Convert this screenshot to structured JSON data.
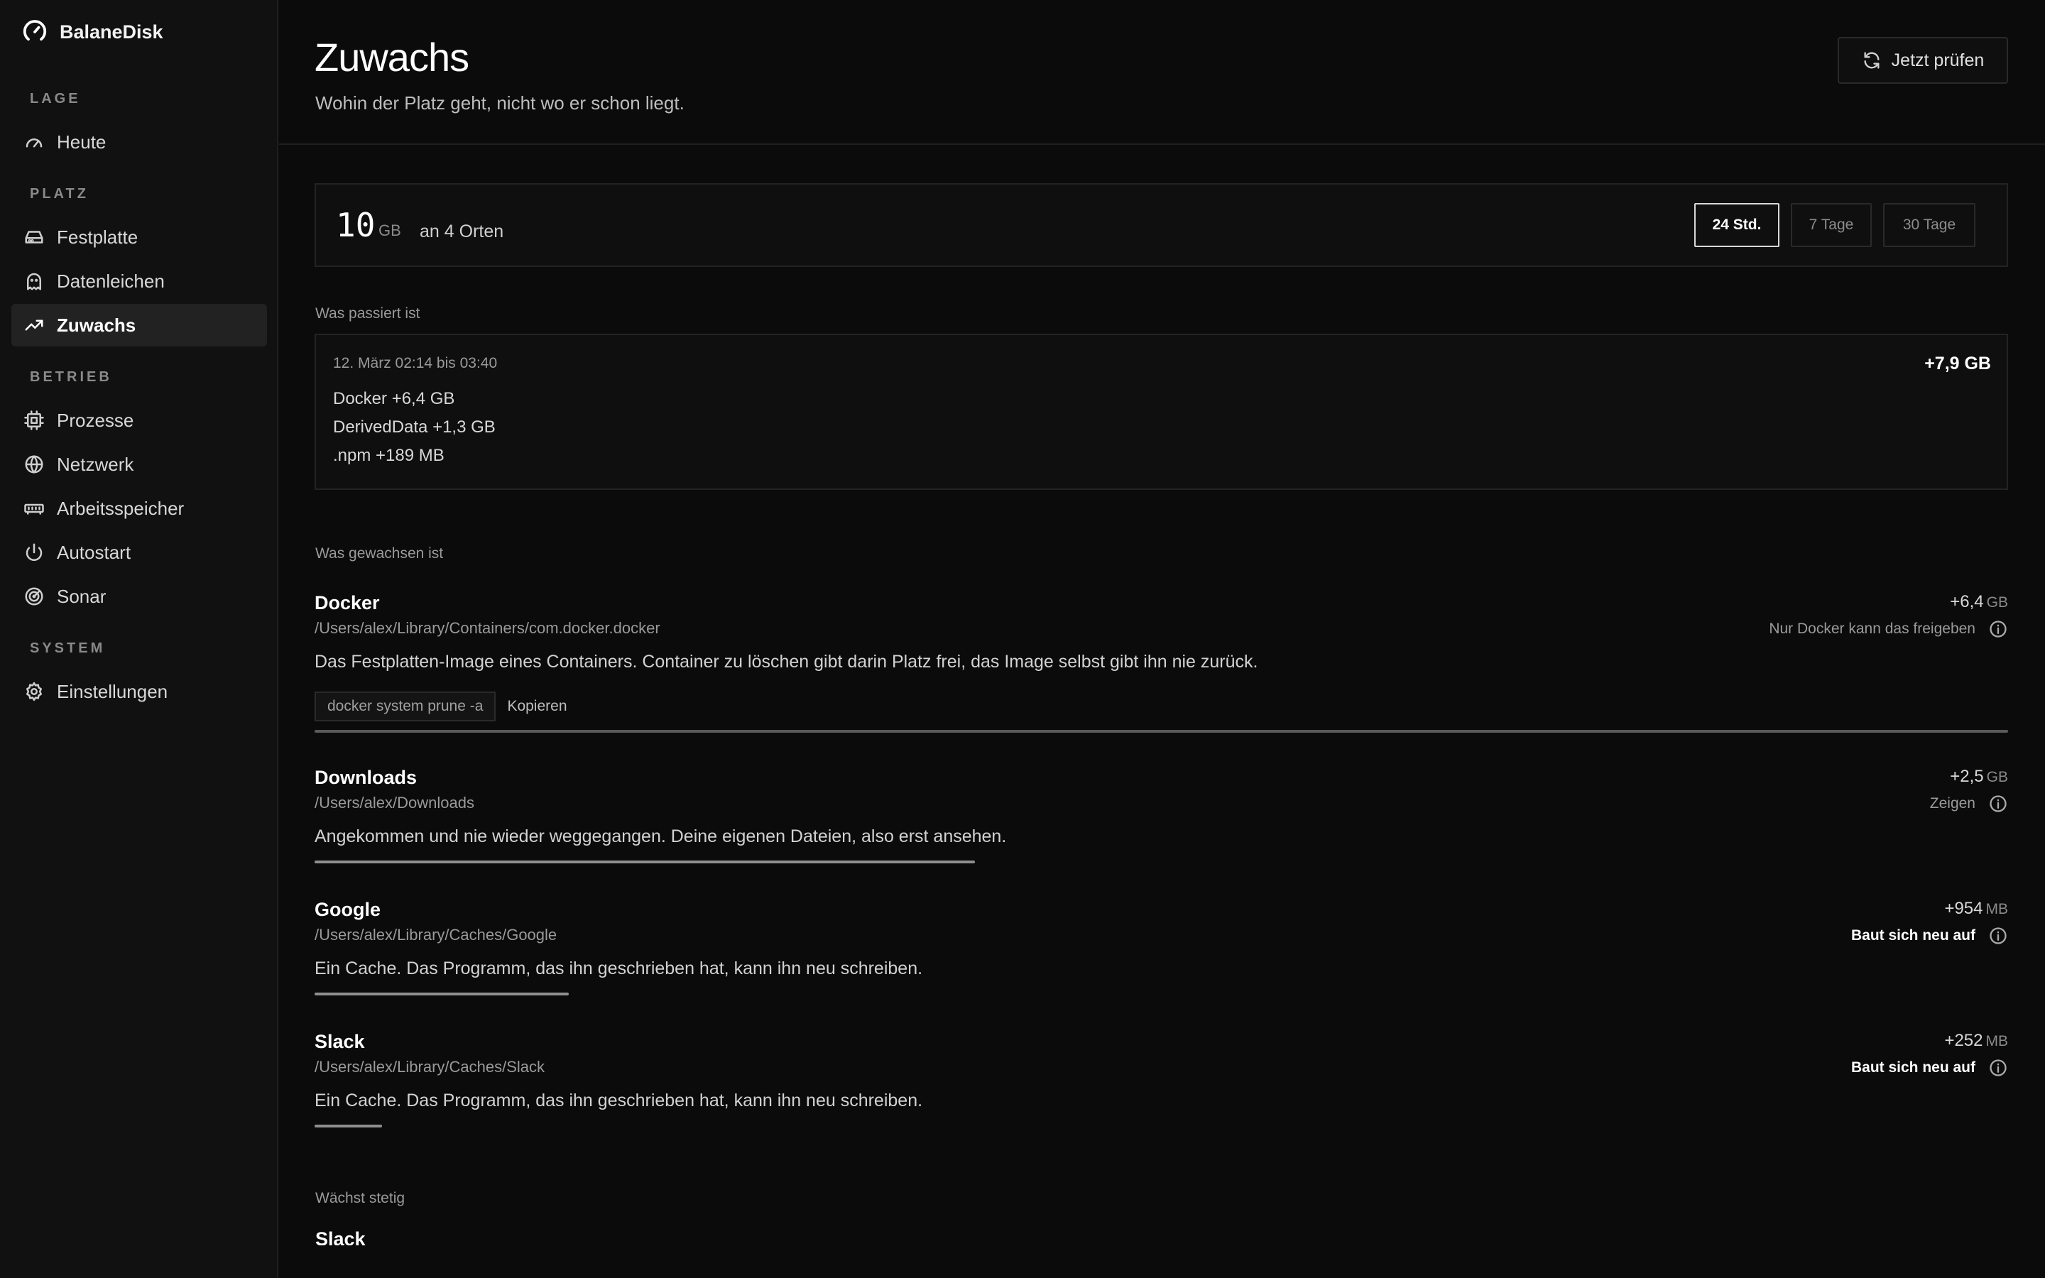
{
  "app": {
    "name": "BalaneDisk"
  },
  "sidebar": {
    "sections": [
      {
        "title": "LAGE",
        "items": [
          {
            "label": "Heute",
            "icon": "gauge-icon"
          }
        ]
      },
      {
        "title": "PLATZ",
        "items": [
          {
            "label": "Festplatte",
            "icon": "hard-drive-icon"
          },
          {
            "label": "Datenleichen",
            "icon": "ghost-icon"
          },
          {
            "label": "Zuwachs",
            "icon": "trending-up-icon",
            "active": true
          }
        ]
      },
      {
        "title": "BETRIEB",
        "items": [
          {
            "label": "Prozesse",
            "icon": "cpu-icon"
          },
          {
            "label": "Netzwerk",
            "icon": "globe-icon"
          },
          {
            "label": "Arbeitsspeicher",
            "icon": "memory-icon"
          },
          {
            "label": "Autostart",
            "icon": "power-icon"
          },
          {
            "label": "Sonar",
            "icon": "radar-icon"
          }
        ]
      },
      {
        "title": "SYSTEM",
        "items": [
          {
            "label": "Einstellungen",
            "icon": "gear-icon"
          }
        ]
      }
    ]
  },
  "header": {
    "title": "Zuwachs",
    "subtitle": "Wohin der Platz geht, nicht wo er schon liegt.",
    "check_button": "Jetzt prüfen"
  },
  "summary": {
    "value": "10",
    "unit": "GB",
    "locations": "an 4 Orten",
    "ranges": [
      "24 Std.",
      "7 Tage",
      "30 Tage"
    ],
    "active_range": "24 Std."
  },
  "event_section": {
    "label": "Was passiert ist",
    "time": "12. März 02:14 bis 03:40",
    "total": "+7,9 GB",
    "lines": [
      "Docker +6,4 GB",
      "DerivedData +1,3 GB",
      ".npm +189 MB"
    ]
  },
  "growth_section": {
    "label": "Was gewachsen ist",
    "items": [
      {
        "name": "Docker",
        "path": "/Users/alex/Library/Containers/com.docker.docker",
        "desc": "Das Festplatten-Image eines Containers. Container zu löschen gibt darin Platz frei, das Image selbst gibt ihn nie zurück.",
        "delta": "+6,4",
        "unit": "GB",
        "action": "Nur Docker kann das freigeben",
        "command": "docker system prune -a",
        "copy_label": "Kopieren",
        "share": 1.0
      },
      {
        "name": "Downloads",
        "path": "/Users/alex/Downloads",
        "desc": "Angekommen und nie wieder weggegangen. Deine eigenen Dateien, also erst ansehen.",
        "delta": "+2,5",
        "unit": "GB",
        "action": "Zeigen",
        "share": 0.39
      },
      {
        "name": "Google",
        "path": "/Users/alex/Library/Caches/Google",
        "desc": "Ein Cache. Das Programm, das ihn geschrieben hat, kann ihn neu schreiben.",
        "delta": "+954",
        "unit": "MB",
        "action": "Baut sich neu auf",
        "share": 0.15
      },
      {
        "name": "Slack",
        "path": "/Users/alex/Library/Caches/Slack",
        "desc": "Ein Cache. Das Programm, das ihn geschrieben hat, kann ihn neu schreiben.",
        "delta": "+252",
        "unit": "MB",
        "action": "Baut sich neu auf",
        "share": 0.04
      }
    ]
  },
  "steady_section": {
    "label": "Wächst stetig",
    "first_item": "Slack"
  }
}
